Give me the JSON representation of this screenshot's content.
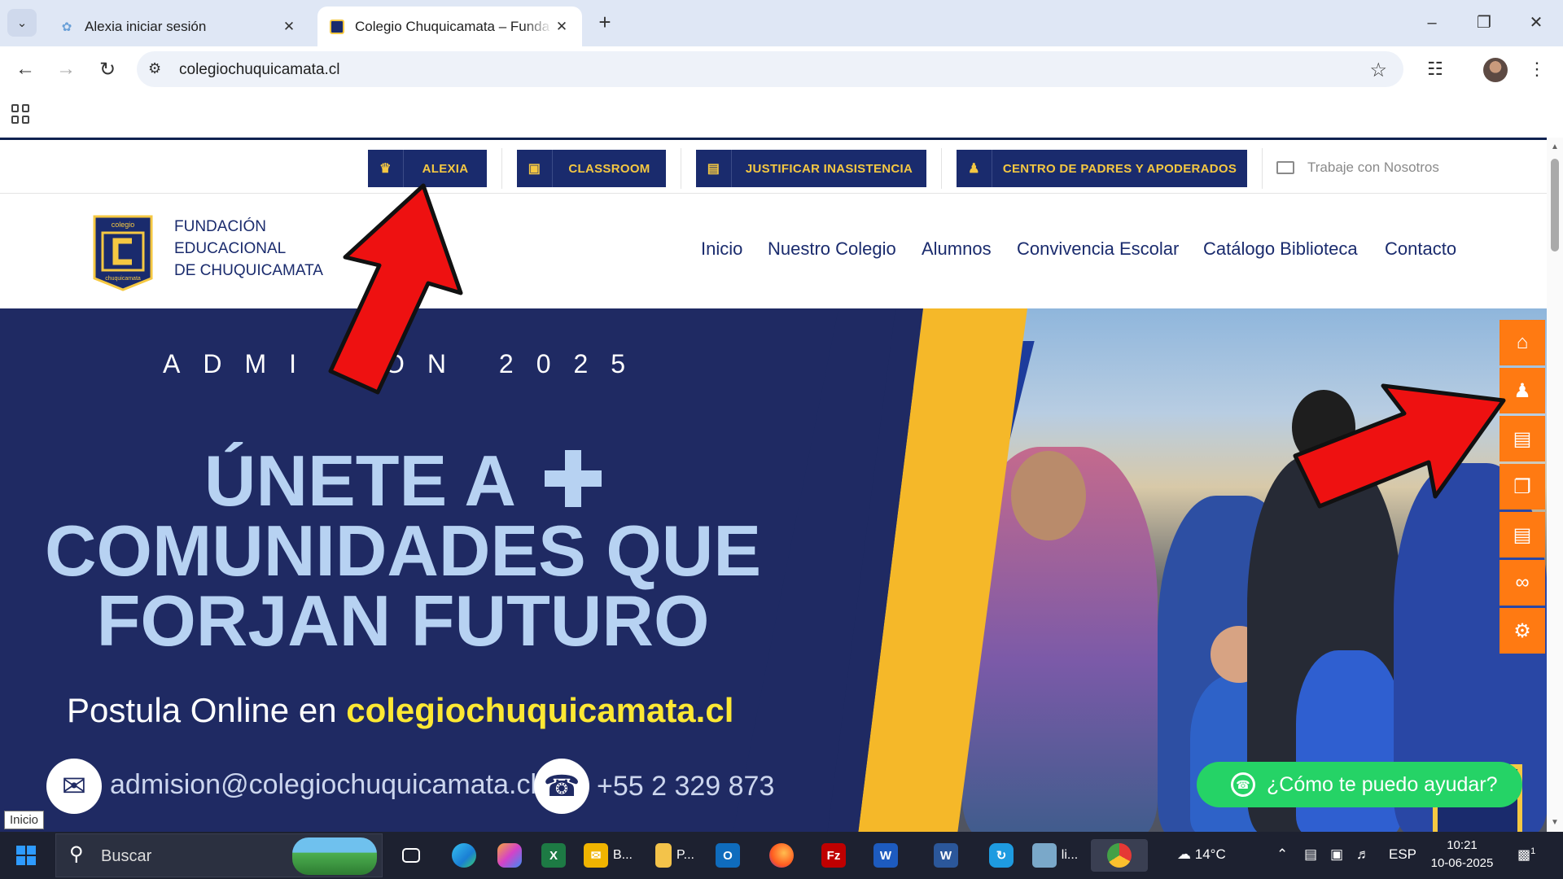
{
  "browser": {
    "tabs": [
      {
        "title": "Alexia iniciar sesión",
        "active": false
      },
      {
        "title": "Colegio Chuquicamata – Funda",
        "active": true
      }
    ],
    "url": "colegiochuquicamata.cl"
  },
  "site": {
    "topbar": {
      "buttons": [
        {
          "label": "ALEXIA",
          "icon": "graduate-icon"
        },
        {
          "label": "CLASSROOM",
          "icon": "book-icon"
        },
        {
          "label": "JUSTIFICAR INASISTENCIA",
          "icon": "document-icon"
        },
        {
          "label": "CENTRO DE PADRES Y APODERADOS",
          "icon": "users-icon"
        }
      ],
      "work_link": "Trabaje con Nosotros"
    },
    "logo": {
      "top": "colegio",
      "bottom": "chuquicamata"
    },
    "org_name": [
      "FUNDACIÓN",
      "EDUCACIONAL",
      "DE CHUQUICAMATA"
    ],
    "menu": [
      "Inicio",
      "Nuestro Colegio",
      "Alumnos",
      "Convivencia Escolar",
      "Catálogo Biblioteca",
      "Contacto"
    ],
    "hero": {
      "admission": "ADMI",
      "admission_tail": "ÓN 2025",
      "headline": [
        "ÚNETE A",
        "COMUNIDADES QUE",
        "FORJAN FUTURO"
      ],
      "postula_prefix": "Postula Online en",
      "postula_site": "colegiochuquicamata.cl",
      "email": "admision@colegiochuquicamata.cl",
      "phone": "+55 2 329 873"
    },
    "side_menu": [
      "home-icon",
      "user-icon",
      "save-icon",
      "copy-icon",
      "save-icon",
      "link-icon",
      "gear-icon"
    ],
    "whatsapp": "¿Cómo te puedo ayudar?",
    "tooltip": "Inicio"
  },
  "taskbar": {
    "search": "Buscar",
    "apps": [
      {
        "label": "B...",
        "color": "#f0b400"
      },
      {
        "label": "P...",
        "color": "#f3c34a"
      },
      {
        "label": "li...",
        "color": "#7aa8c9"
      }
    ],
    "weather": "14°C",
    "lang": "ESP",
    "time": "10:21",
    "date": "10-06-2025",
    "notifications": "1"
  },
  "colors": {
    "navy": "#1a2b6d",
    "gold": "#f5c842",
    "orange": "#ff7a12",
    "whatsapp": "#25d366",
    "arrow": "#ee1111"
  }
}
